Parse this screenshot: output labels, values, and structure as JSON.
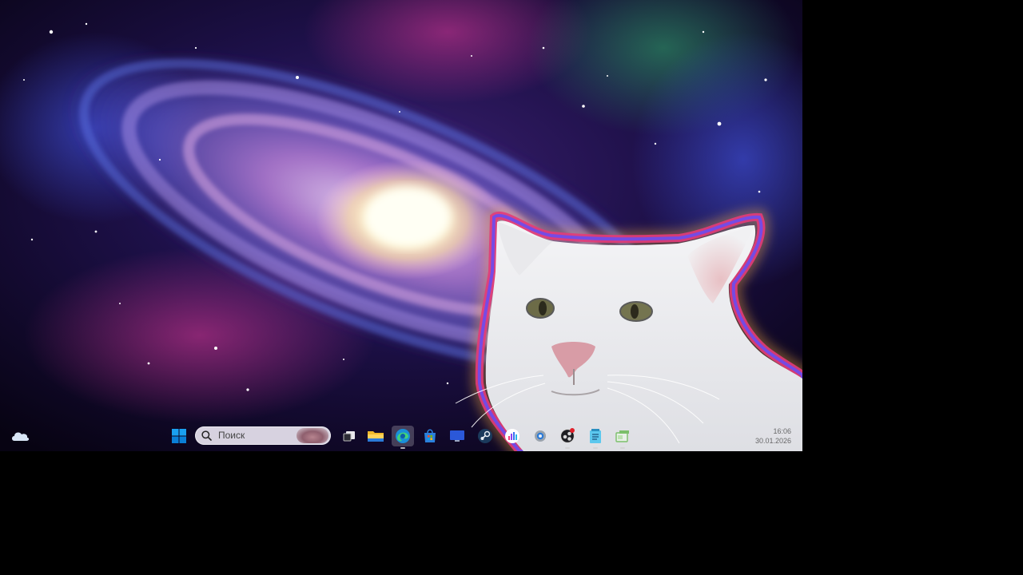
{
  "taskbar": {
    "search": {
      "placeholder": "Поиск"
    },
    "clock": {
      "time": "16:06",
      "date": "30.01.2026"
    },
    "apps": [
      {
        "name": "start-button",
        "icon": "windows-icon"
      },
      {
        "name": "task-view",
        "icon": "task-view-icon"
      },
      {
        "name": "file-explorer",
        "icon": "folder-icon"
      },
      {
        "name": "edge",
        "icon": "edge-icon",
        "active": true
      },
      {
        "name": "store",
        "icon": "store-icon"
      },
      {
        "name": "remote-desktop",
        "icon": "monitor-icon"
      },
      {
        "name": "steam",
        "icon": "steam-icon"
      },
      {
        "name": "stats-app",
        "icon": "bar-chart-icon"
      },
      {
        "name": "settings",
        "icon": "gear-icon"
      },
      {
        "name": "obs",
        "icon": "obs-icon"
      },
      {
        "name": "notepad",
        "icon": "notepad-icon"
      },
      {
        "name": "app-manager",
        "icon": "window-icon"
      }
    ]
  },
  "colors": {
    "accent": "#0a7fd6",
    "folder": "#f0b92c",
    "notification_badge": "#e0202a"
  }
}
